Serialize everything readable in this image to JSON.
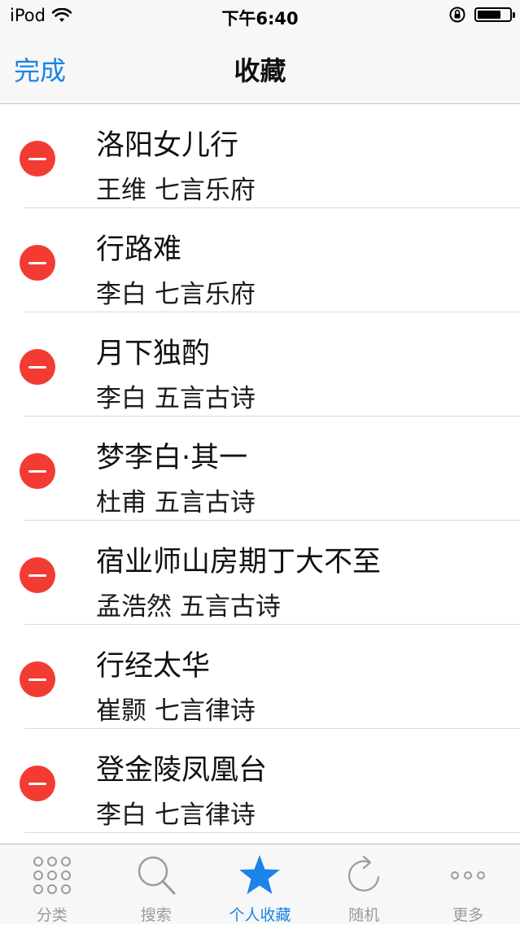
{
  "status_bar": {
    "device": "iPod",
    "time": "下午6:40",
    "battery_level": 0.75
  },
  "nav": {
    "done_label": "完成",
    "title": "收藏"
  },
  "favorites": [
    {
      "title": "洛阳女儿行",
      "subtitle": "王维 七言乐府"
    },
    {
      "title": "行路难",
      "subtitle": "李白 七言乐府"
    },
    {
      "title": "月下独酌",
      "subtitle": "李白 五言古诗"
    },
    {
      "title": "梦李白·其一",
      "subtitle": "杜甫 五言古诗"
    },
    {
      "title": "宿业师山房期丁大不至",
      "subtitle": "孟浩然 五言古诗"
    },
    {
      "title": "行经太华",
      "subtitle": "崔颢 七言律诗"
    },
    {
      "title": "登金陵凤凰台",
      "subtitle": "李白 七言律诗"
    }
  ],
  "tab_bar": {
    "tabs": [
      {
        "label": "分类",
        "icon": "grid-dots-icon"
      },
      {
        "label": "搜索",
        "icon": "search-icon"
      },
      {
        "label": "个人收藏",
        "icon": "star-icon"
      },
      {
        "label": "随机",
        "icon": "refresh-icon"
      },
      {
        "label": "更多",
        "icon": "more-icon"
      }
    ],
    "active_index": 2
  },
  "colors": {
    "accent": "#1a84e8",
    "delete": "#f23c33",
    "inactive_tab": "#9b9b9b"
  }
}
